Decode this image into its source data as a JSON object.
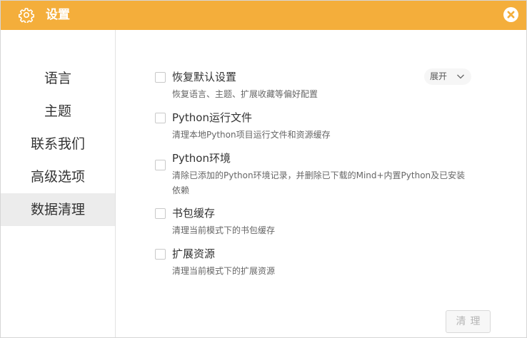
{
  "titlebar": {
    "title": "设置",
    "icon": "gear-icon",
    "close_icon": "close-icon"
  },
  "colors": {
    "titlebar_bg": "#f4ae3b",
    "sidebar_active_bg": "#ececec"
  },
  "sidebar": {
    "items": [
      {
        "label": "语言",
        "active": false
      },
      {
        "label": "主题",
        "active": false
      },
      {
        "label": "联系我们",
        "active": false
      },
      {
        "label": "高级选项",
        "active": false
      },
      {
        "label": "数据清理",
        "active": true
      }
    ]
  },
  "options": [
    {
      "title": "恢复默认设置",
      "desc": "恢复语言、主题、扩展收藏等偏好配置",
      "checked": false
    },
    {
      "title": "Python运行文件",
      "desc": "清理本地Python项目运行文件和资源缓存",
      "checked": false
    },
    {
      "title": "Python环境",
      "desc": "清除已添加的Python环境记录，并删除已下载的Mind+内置Python及已安装依赖",
      "checked": false
    },
    {
      "title": "书包缓存",
      "desc": "清理当前模式下的书包缓存",
      "checked": false
    },
    {
      "title": "扩展资源",
      "desc": "清理当前模式下的扩展资源",
      "checked": false
    }
  ],
  "expand": {
    "label": "展开",
    "icon": "chevron-down-icon"
  },
  "clean_button": {
    "label": "清理"
  }
}
